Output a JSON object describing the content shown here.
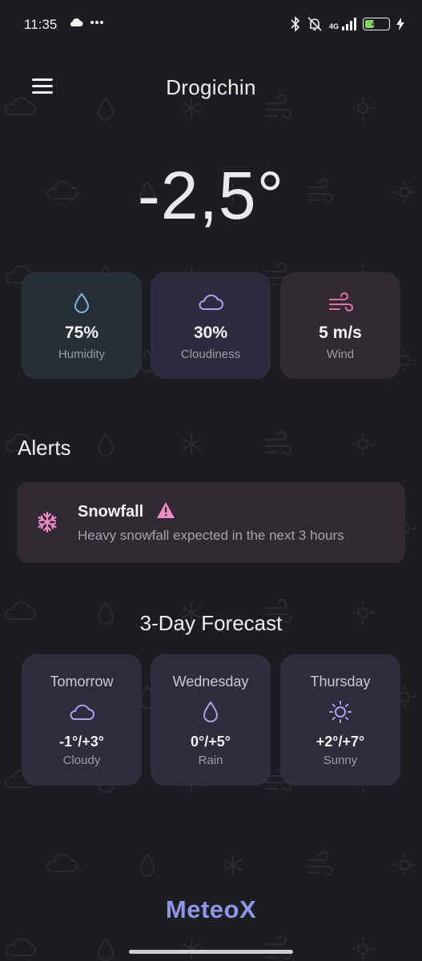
{
  "status_bar": {
    "time": "11:35",
    "network": "4G",
    "battery_level": "40",
    "battery_color": "#7ed957"
  },
  "header": {
    "menu_icon": "hamburger-menu-icon",
    "city": "Drogichin"
  },
  "current": {
    "temperature": "-2,5°"
  },
  "stats": [
    {
      "icon": "droplet-icon",
      "value": "75%",
      "label": "Humidity",
      "color": "#7eb6e0",
      "bg": "#263039"
    },
    {
      "icon": "cloud-icon",
      "value": "30%",
      "label": "Cloudiness",
      "color": "#b49cf0",
      "bg": "#2d2b3d"
    },
    {
      "icon": "wind-icon",
      "value": "5 m/s",
      "label": "Wind",
      "color": "#e66fa6",
      "bg": "#322a33"
    }
  ],
  "alerts": {
    "title": "Alerts",
    "items": [
      {
        "icon": "snowflake-icon",
        "title": "Snowfall",
        "warning_icon": "warning-triangle-icon",
        "description": "Heavy snowfall expected in the next 3 hours",
        "color": "#f08bc8"
      }
    ]
  },
  "forecast": {
    "title": "3-Day Forecast",
    "days": [
      {
        "day": "Tomorrow",
        "icon": "cloud-icon",
        "temp": "-1°/+3°",
        "condition": "Cloudy"
      },
      {
        "day": "Wednesday",
        "icon": "droplet-icon",
        "temp": "0°/+5°",
        "condition": "Rain"
      },
      {
        "day": "Thursday",
        "icon": "sun-icon",
        "temp": "+2°/+7°",
        "condition": "Sunny"
      }
    ],
    "icon_color": "#b49cf0"
  },
  "footer": {
    "brand": "MeteoX"
  }
}
